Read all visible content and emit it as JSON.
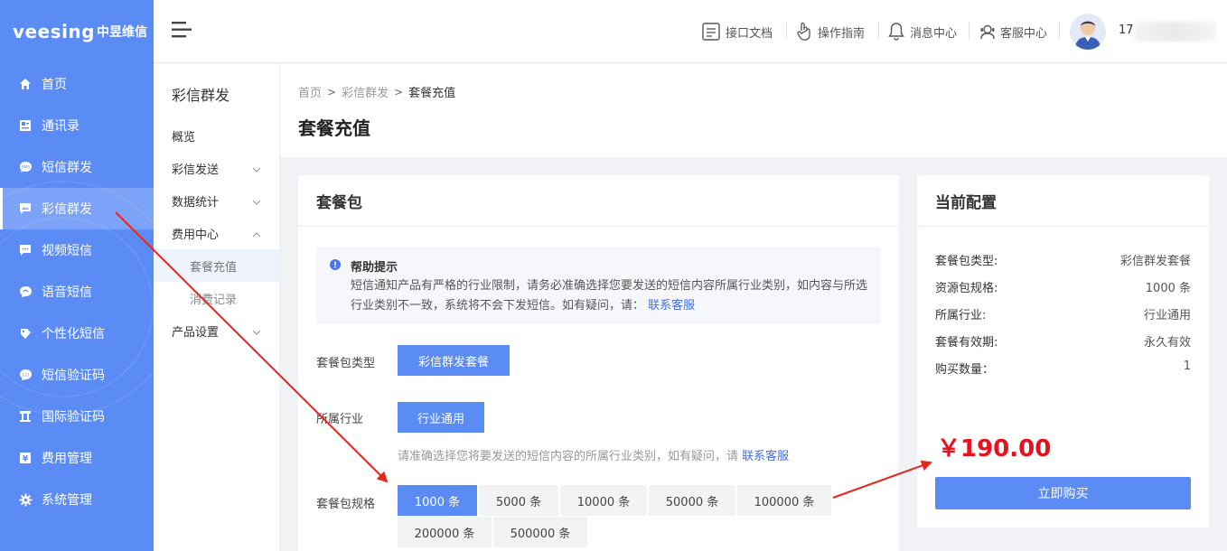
{
  "brand": {
    "logo_text": "veesing",
    "logo_cn": "中昱维信"
  },
  "sidebar": {
    "items": [
      {
        "label": "首页",
        "icon": "home-icon"
      },
      {
        "label": "通讯录",
        "icon": "contacts-icon"
      },
      {
        "label": "短信群发",
        "icon": "sms-icon"
      },
      {
        "label": "彩信群发",
        "icon": "mms-icon",
        "active": true
      },
      {
        "label": "视频短信",
        "icon": "video-sms-icon"
      },
      {
        "label": "语音短信",
        "icon": "voice-sms-icon"
      },
      {
        "label": "个性化短信",
        "icon": "personalized-sms-icon"
      },
      {
        "label": "短信验证码",
        "icon": "sms-code-icon"
      },
      {
        "label": "国际验证码",
        "icon": "intl-code-icon"
      },
      {
        "label": "费用管理",
        "icon": "yen-icon"
      },
      {
        "label": "系统管理",
        "icon": "gear-icon"
      }
    ]
  },
  "topbar": {
    "links": [
      {
        "label": "接口文档",
        "icon": "doc-icon"
      },
      {
        "label": "操作指南",
        "icon": "hand-pointer-icon"
      },
      {
        "label": "消息中心",
        "icon": "bell-icon"
      },
      {
        "label": "客服中心",
        "icon": "support-icon"
      }
    ],
    "user_prefix": "17"
  },
  "submenu": {
    "title": "彩信群发",
    "items": {
      "overview": "概览",
      "send": "彩信发送",
      "stats": "数据统计",
      "billing": "费用中心",
      "recharge": "套餐充值",
      "records": "消费记录",
      "product": "产品设置"
    }
  },
  "breadcrumb": {
    "home": "首页",
    "section": "彩信群发",
    "current": "套餐充值"
  },
  "page_title": "套餐充值",
  "package": {
    "title": "套餐包",
    "help_title": "帮助提示",
    "help_text": "短信通知产品有严格的行业限制，请务必准确选择您要发送的短信内容所属行业类别，如内容与所选行业类别不一致，系统将不会下发短信。如有疑问，请：",
    "help_link": "联系客服",
    "type_label": "套餐包类型",
    "type_option": "彩信群发套餐",
    "industry_label": "所属行业",
    "industry_option": "行业通用",
    "industry_hint": "请准确选择您将要发送的短信内容的所属行业类别，如有疑问，请",
    "industry_hint_link": "联系客服",
    "spec_label": "套餐包规格",
    "specs": [
      "1000 条",
      "5000 条",
      "10000 条",
      "50000 条",
      "100000 条",
      "200000 条",
      "500000 条"
    ],
    "selected_spec": "1000 条"
  },
  "config": {
    "title": "当前配置",
    "rows": [
      {
        "k": "套餐包类型:",
        "v": "彩信群发套餐"
      },
      {
        "k": "资源包规格:",
        "v": "1000 条"
      },
      {
        "k": "所属行业:",
        "v": "行业通用"
      },
      {
        "k": "套餐有效期:",
        "v": "永久有效"
      },
      {
        "k": "购买数量：",
        "v": "1"
      }
    ],
    "price": "￥190.00",
    "buy_label": "立即购买"
  },
  "colors": {
    "primary": "#5b8cf5",
    "price": "#e8101b",
    "annotation_arrow": "#e8251b"
  }
}
